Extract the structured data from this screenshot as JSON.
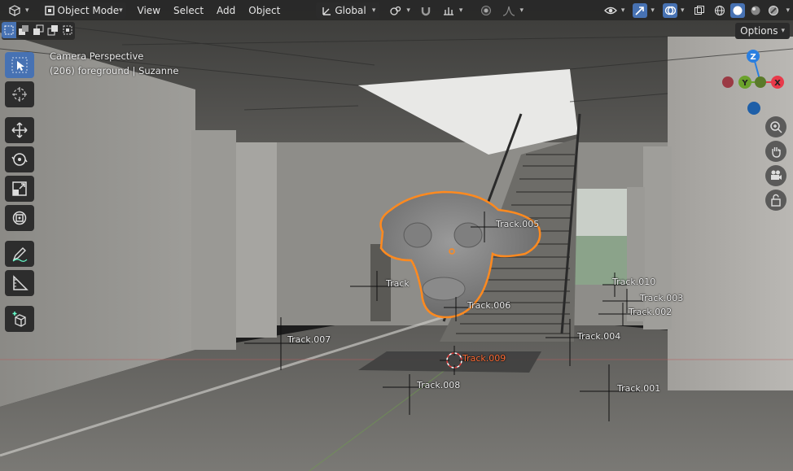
{
  "header": {
    "editor_type_icon": "3d-viewport-icon",
    "mode": "Object Mode",
    "menus": [
      "View",
      "Select",
      "Add",
      "Object"
    ],
    "transform_orientation": "Global",
    "options_label": "Options"
  },
  "overlay": {
    "view_name": "Camera Perspective",
    "object_info": "(206) foreground | Suzanne"
  },
  "gizmo": {
    "z_label": "Z",
    "x_label": "X",
    "y_label": "Y"
  },
  "tracks": [
    {
      "label": "Track.005",
      "active": false
    },
    {
      "label": "Track",
      "active": false
    },
    {
      "label": "Track.006",
      "active": false
    },
    {
      "label": "Track.010",
      "active": false
    },
    {
      "label": "Track.003",
      "active": false
    },
    {
      "label": "Track.002",
      "active": false
    },
    {
      "label": "Track.004",
      "active": false
    },
    {
      "label": "Track.007",
      "active": false
    },
    {
      "label": "Track.009",
      "active": true
    },
    {
      "label": "Track.008",
      "active": false
    },
    {
      "label": "Track.001",
      "active": false
    }
  ],
  "colors": {
    "selection_outline": "#ff8a1f",
    "active_track": "#ff6d37",
    "accent": "#4772b3",
    "axis_x": "#e83a4a",
    "axis_y": "#6ba22c",
    "axis_z": "#2a7fe0"
  }
}
